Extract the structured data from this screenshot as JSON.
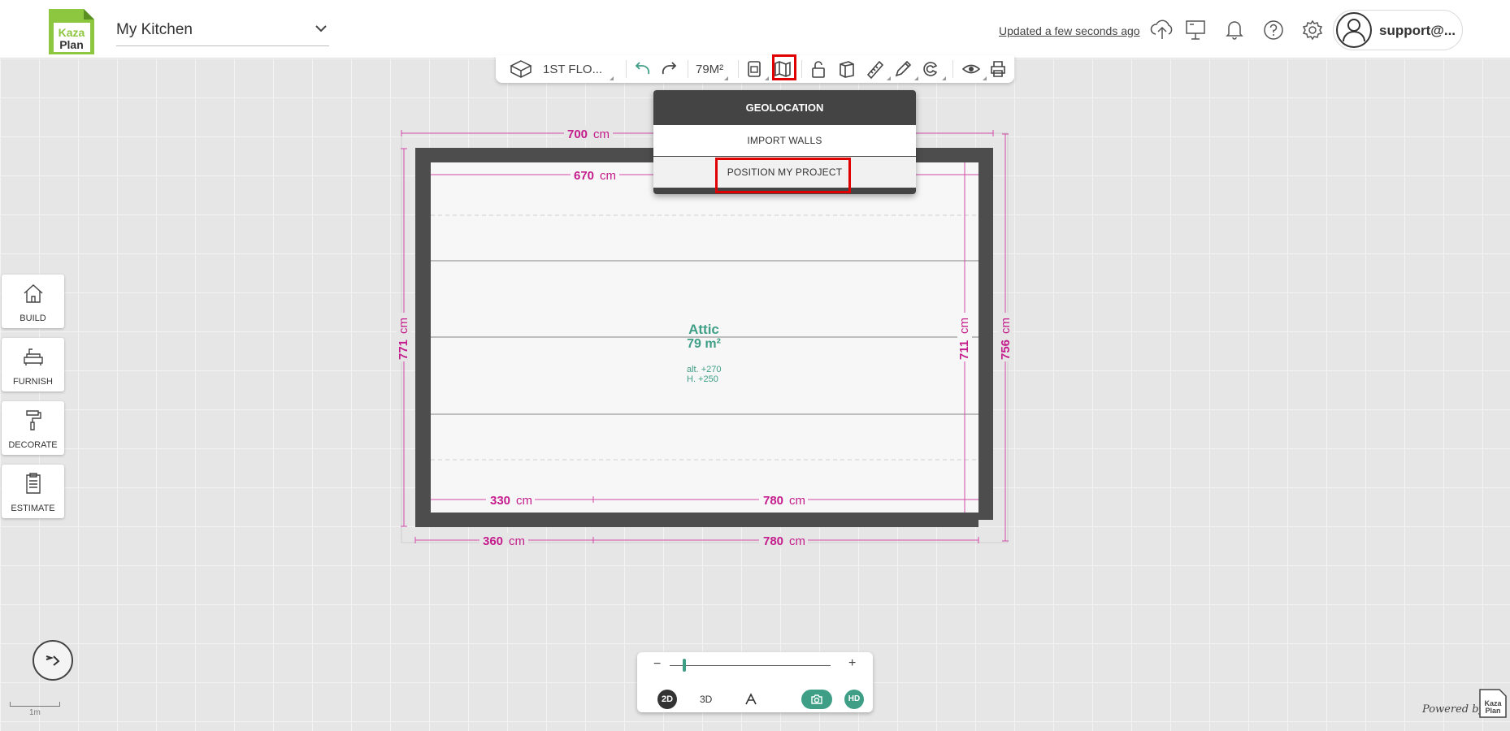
{
  "header": {
    "logo_text_top": "Kaza",
    "logo_text_bottom": "Plan",
    "project_name": "My Kitchen",
    "status": "Updated a few seconds ago",
    "user_name": "support@..."
  },
  "toolbar": {
    "floor": "1ST FLO...",
    "area": "79M²"
  },
  "dropdown": {
    "title": "GEOLOCATION",
    "items": [
      "IMPORT WALLS",
      "POSITION MY PROJECT"
    ]
  },
  "sidebar": {
    "items": [
      {
        "label": "BUILD"
      },
      {
        "label": "FURNISH"
      },
      {
        "label": "DECORATE"
      },
      {
        "label": "ESTIMATE"
      }
    ]
  },
  "plan": {
    "room_name": "Attic",
    "room_area": "79 m²",
    "altitude": "alt. +270",
    "height": "H.  +250",
    "dims": {
      "top_outer": "700",
      "top_inner": "670",
      "left_outer": "771",
      "right_inner": "711",
      "right_outer": "756",
      "bottom_inner_left": "330",
      "bottom_inner_right": "780",
      "bottom_outer_left": "360",
      "bottom_outer_right": "780"
    },
    "unit": "cm"
  },
  "view": {
    "mode_2d": "2D",
    "mode_3d": "3D",
    "hd": "HD",
    "zoom_minus": "−",
    "zoom_plus": "+",
    "zoom_level": 0.08
  },
  "scale": {
    "label": "1m"
  },
  "footer": {
    "powered": "Powered by"
  },
  "colors": {
    "accent": "#3f9f86",
    "dimension": "#c41c8c",
    "highlight": "#e00000",
    "wall": "#4d4d4d"
  }
}
